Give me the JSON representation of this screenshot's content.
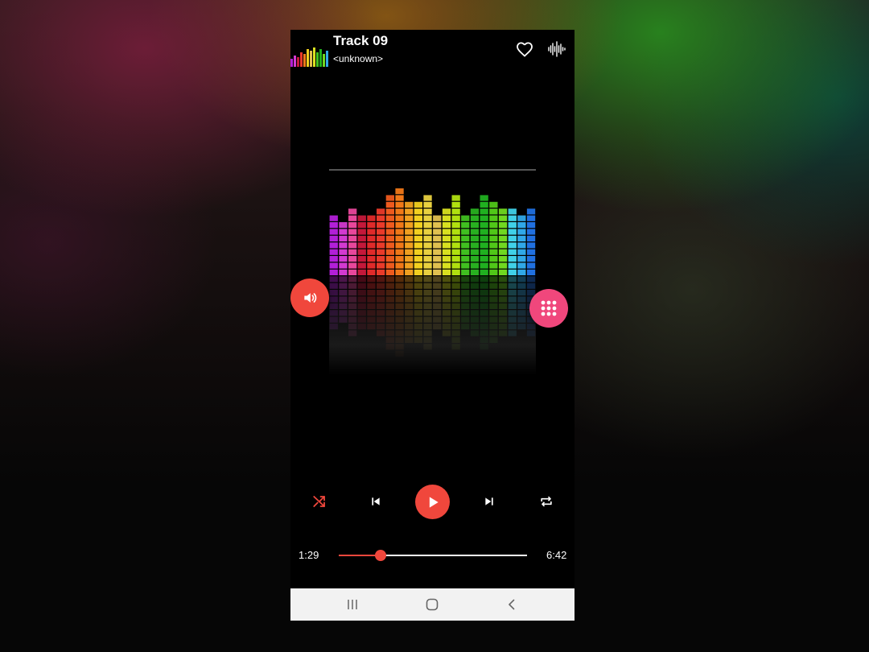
{
  "track": {
    "title": "Track 09",
    "artist": "<unknown>"
  },
  "header": {
    "favorite_icon": "heart-outline-icon",
    "visualizer_icon": "waveform-icon"
  },
  "album_art": {
    "description_icon": "equalizer-bars-art"
  },
  "side_buttons": {
    "volume_icon": "volume-icon",
    "menu_icon": "grid-dots-icon"
  },
  "controls": {
    "shuffle_icon": "shuffle-icon",
    "prev_icon": "skip-previous-icon",
    "play_icon": "play-icon",
    "next_icon": "skip-next-icon",
    "repeat_icon": "repeat-icon"
  },
  "progress": {
    "current": "1:29",
    "total": "6:42",
    "fraction": 0.221
  },
  "colors": {
    "accent": "#f0473c",
    "accent_pink": "#f0477c",
    "background": "#000000",
    "navbar": "#f2f2f2"
  },
  "navbar": {
    "recents_icon": "recents-icon",
    "home_icon": "home-icon",
    "back_icon": "back-icon"
  }
}
